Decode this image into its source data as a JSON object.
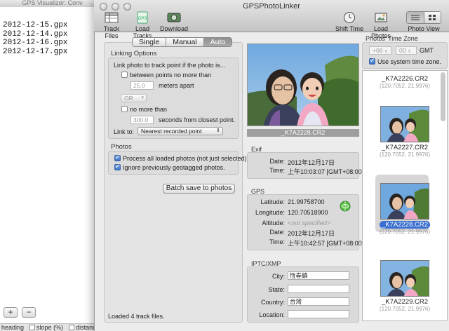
{
  "background_window": {
    "title": "GPS Visualizer: Conv",
    "files": [
      "2012-12-15.gpx",
      "2012-12-14.gpx",
      "2012-12-16.gpx",
      "2012-12-17.gpx"
    ],
    "add_label": "+",
    "remove_label": "−",
    "bottom_bar": [
      "heading",
      "slope (%)",
      "distance"
    ]
  },
  "window": {
    "title": "GPSPhotoLinker"
  },
  "toolbar": {
    "track_files": "Track Files",
    "load_tracks": "Load Tracks",
    "download": "Download",
    "shift_time": "Shift Time",
    "load_photos": "Load Photos",
    "photo_view": "Photo View"
  },
  "mode": {
    "options": [
      "Single",
      "Manual",
      "Auto"
    ],
    "selected": "Auto"
  },
  "linking": {
    "group_title": "Linking Options",
    "intro": "Link photo to track point if the photo is...",
    "between_label": "between points no more than",
    "meters_value": "25.0",
    "meters_suffix": "meters apart",
    "logic_value": "OR",
    "no_more_than_label": "no more than",
    "seconds_value": "300.0",
    "seconds_suffix": "seconds from closest point.",
    "link_to_label": "Link to:",
    "link_to_value": "Nearest recorded point"
  },
  "photos": {
    "group_title": "Photos",
    "process_all": "Process all loaded photos (not just selected).",
    "ignore_geotagged": "Ignore previously geotagged photos.",
    "batch_button": "Batch save to photos"
  },
  "status": "Loaded 4 track files.",
  "current_photo": {
    "name": "_K7A2228.CR2"
  },
  "exif": {
    "title": "Exif",
    "date_label": "Date:",
    "date": "2012年12月17日",
    "time_label": "Time:",
    "time": "上午10:03:07 [GMT+08:00]"
  },
  "gps": {
    "title": "GPS",
    "latitude_label": "Latitude:",
    "latitude": "21.99758700",
    "longitude_label": "Longitude:",
    "longitude": "120.70518900",
    "altitude_label": "Altitude:",
    "altitude": "<not specified>",
    "date_label": "Date:",
    "date": "2012年12月17日",
    "time_label": "Time:",
    "time": "上午10:42:57 [GMT+08:00]"
  },
  "iptc": {
    "title": "IPTC/XMP",
    "city_label": "City:",
    "city": "恆春鎮",
    "state_label": "State:",
    "state": "",
    "country_label": "Country:",
    "country": "台灣",
    "location_label": "Location:",
    "location": ""
  },
  "timezone": {
    "title": "Photos' Time Zone",
    "hours": "+08",
    "minutes": "00",
    "gmt_label": "GMT",
    "use_system": "Use system time zone."
  },
  "thumbnails": [
    {
      "name": "_K7A2226.CR2",
      "coords": "(120.7052, 21.9976)",
      "selected": false
    },
    {
      "name": "_K7A2227.CR2",
      "coords": "(120.7052, 21.9976)",
      "selected": false
    },
    {
      "name": "_K7A2228.CR2",
      "coords": "(120.7052, 21.9976)",
      "selected": true
    },
    {
      "name": "_K7A2229.CR2",
      "coords": "(120.7052, 21.9976)",
      "selected": false
    }
  ],
  "icons": {
    "track_files": "table-icon",
    "load_tracks": "gps-file-icon",
    "download": "download-icon",
    "shift_time": "clock-icon",
    "load_photos": "photo-load-icon",
    "photo_view": "view-switch-icon",
    "geotag": "globe-icon"
  },
  "colors": {
    "selection": "#3a6fd0",
    "segment_active": "#9c9c9c"
  }
}
